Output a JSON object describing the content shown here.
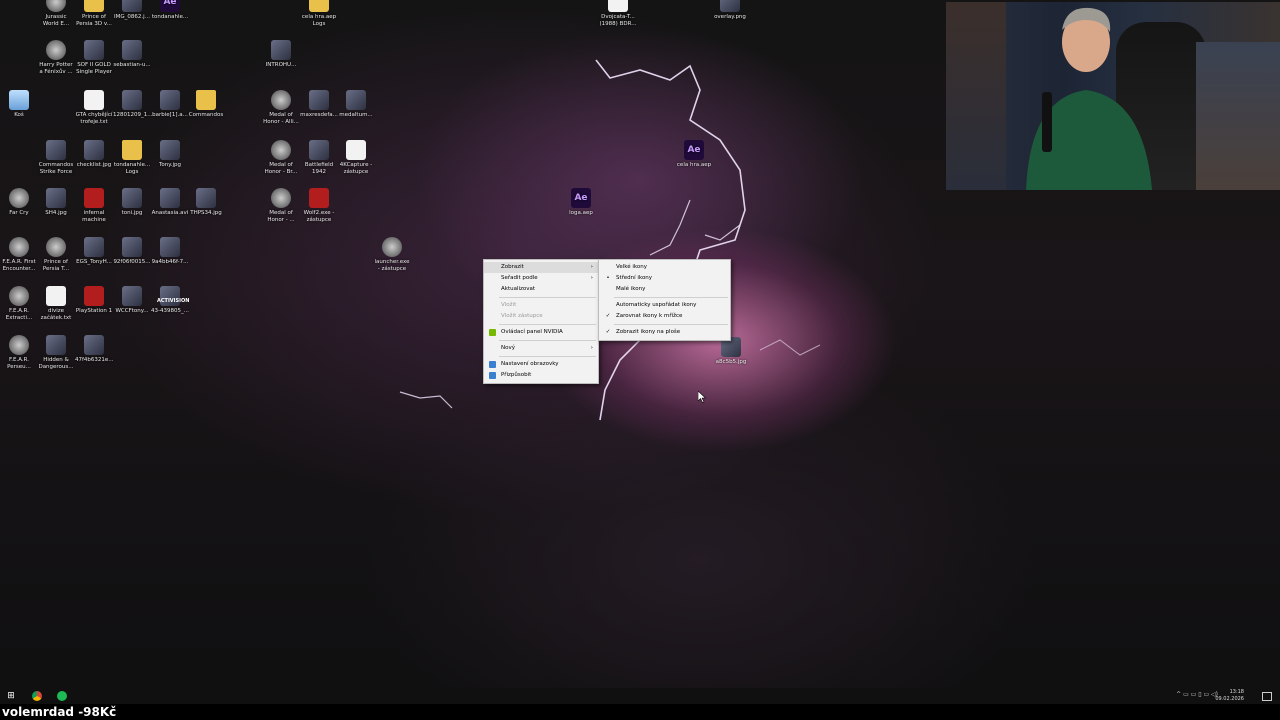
{
  "desktop": {
    "icons": [
      {
        "label": "Jurassic World E...",
        "kind": "app"
      },
      {
        "label": "Prince of Persia 3D v...",
        "kind": "folder"
      },
      {
        "label": "IMG_0862.j...",
        "kind": "img"
      },
      {
        "label": "tondanahle...",
        "kind": "ae"
      },
      {
        "label": "cela hra.aep Logs",
        "kind": "folder"
      },
      {
        "label": "Dvojcata-T... (1988) BDR...",
        "kind": "file"
      },
      {
        "label": "overlay.png",
        "kind": "img"
      },
      {
        "label": "Harry Potter a Fénixův ...",
        "kind": "app"
      },
      {
        "label": "SOF II GOLD Single Player",
        "kind": "img"
      },
      {
        "label": "sebastian-u...",
        "kind": "img"
      },
      {
        "label": "INTROHU...",
        "kind": "img"
      },
      {
        "label": "Koš",
        "kind": "bin"
      },
      {
        "label": "GTA chybějící trofeje.txt",
        "kind": "file"
      },
      {
        "label": "12801209_1...",
        "kind": "img"
      },
      {
        "label": "barbie[1].a...",
        "kind": "img"
      },
      {
        "label": "Commandos",
        "kind": "folder"
      },
      {
        "label": "Medal of Honor - Alli...",
        "kind": "app"
      },
      {
        "label": "maxresdefa...",
        "kind": "img"
      },
      {
        "label": "medaltum...",
        "kind": "img"
      },
      {
        "label": "Commandos Strike Force",
        "kind": "img"
      },
      {
        "label": "checklist.jpg",
        "kind": "img"
      },
      {
        "label": "tondanahle... Logs",
        "kind": "folder"
      },
      {
        "label": "Tony.jpg",
        "kind": "img"
      },
      {
        "label": "Medal of Honor - Br...",
        "kind": "app"
      },
      {
        "label": "Battlefield 1942",
        "kind": "img"
      },
      {
        "label": "4KCapture - zástupce",
        "kind": "file"
      },
      {
        "label": "cela hra.aep",
        "kind": "ae"
      },
      {
        "label": "Far Cry",
        "kind": "app"
      },
      {
        "label": "SH4.jpg",
        "kind": "img"
      },
      {
        "label": "infernal machine",
        "kind": "red"
      },
      {
        "label": "toni.jpg",
        "kind": "img"
      },
      {
        "label": "Anastasia.avi",
        "kind": "img"
      },
      {
        "label": "THPS34.jpg",
        "kind": "img"
      },
      {
        "label": "Medal of Honor - ...",
        "kind": "app"
      },
      {
        "label": "Wolf2.exe - zástupce",
        "kind": "red"
      },
      {
        "label": "loga.aep",
        "kind": "ae"
      },
      {
        "label": "F.E.A.R. First Encounter...",
        "kind": "app"
      },
      {
        "label": "Prince of Persia T...",
        "kind": "app"
      },
      {
        "label": "EGS_TonyH...",
        "kind": "img"
      },
      {
        "label": "92f06f0015...",
        "kind": "img"
      },
      {
        "label": "9a4bb46f-7...",
        "kind": "img"
      },
      {
        "label": "launcher.exe - zástupce",
        "kind": "app"
      },
      {
        "label": "F.E.A.R. Extracti...",
        "kind": "app"
      },
      {
        "label": "divize začátek.txt",
        "kind": "file"
      },
      {
        "label": "PlayStation 1",
        "kind": "red"
      },
      {
        "label": "WCCFtony...",
        "kind": "img"
      },
      {
        "label": "43-439805_...",
        "kind": "img"
      },
      {
        "label": "F.E.A.R. Perseu...",
        "kind": "app"
      },
      {
        "label": "Hidden & Dangerous...",
        "kind": "img"
      },
      {
        "label": "47f4b6321e...",
        "kind": "img"
      },
      {
        "label": "a8c5b5.jpg",
        "kind": "img"
      }
    ],
    "activision_text": "ACTIVISION"
  },
  "context_menu": {
    "items": [
      {
        "label": "Zobrazit",
        "submenu": true,
        "disabled": false,
        "icon": ""
      },
      {
        "label": "Seřadit podle",
        "submenu": true,
        "disabled": false,
        "icon": ""
      },
      {
        "label": "Aktualizovat",
        "submenu": false,
        "disabled": false,
        "icon": ""
      },
      {
        "sep": true
      },
      {
        "label": "Vložit",
        "submenu": false,
        "disabled": true,
        "icon": ""
      },
      {
        "label": "Vložit zástupce",
        "submenu": false,
        "disabled": true,
        "icon": ""
      },
      {
        "sep": true
      },
      {
        "label": "Ovládací panel NVIDIA",
        "submenu": false,
        "disabled": false,
        "icon": "nvidia-icon"
      },
      {
        "sep": true
      },
      {
        "label": "Nový",
        "submenu": true,
        "disabled": false,
        "icon": ""
      },
      {
        "sep": true
      },
      {
        "label": "Nastavení obrazovky",
        "submenu": false,
        "disabled": false,
        "icon": "display-icon"
      },
      {
        "label": "Přizpůsobit",
        "submenu": false,
        "disabled": false,
        "icon": "personalize-icon"
      }
    ],
    "arrow": "›"
  },
  "submenu": {
    "items": [
      {
        "label": "Velké ikony",
        "mark": ""
      },
      {
        "label": "Střední ikony",
        "mark": "•"
      },
      {
        "label": "Malé ikony",
        "mark": ""
      },
      {
        "sep": true
      },
      {
        "label": "Automaticky uspořádat ikony",
        "mark": ""
      },
      {
        "label": "Zarovnat ikony k mřížce",
        "mark": "✓"
      },
      {
        "sep": true
      },
      {
        "label": "Zobrazit ikony na ploše",
        "mark": "✓"
      }
    ]
  },
  "taskbar": {
    "start_glyph": "⊞",
    "tray_icons": "^ ▭ ▭ ▯ ▭ ◁)",
    "time": "13:18",
    "date": "09.02.2026"
  },
  "caption": {
    "text": "volemrdad -98Kč"
  },
  "colors": {
    "menu_bg": "#f2f2f2",
    "taskbar": "#101010",
    "ae_purple": "#1f0a3a",
    "folder_yellow": "#e8c04a"
  }
}
